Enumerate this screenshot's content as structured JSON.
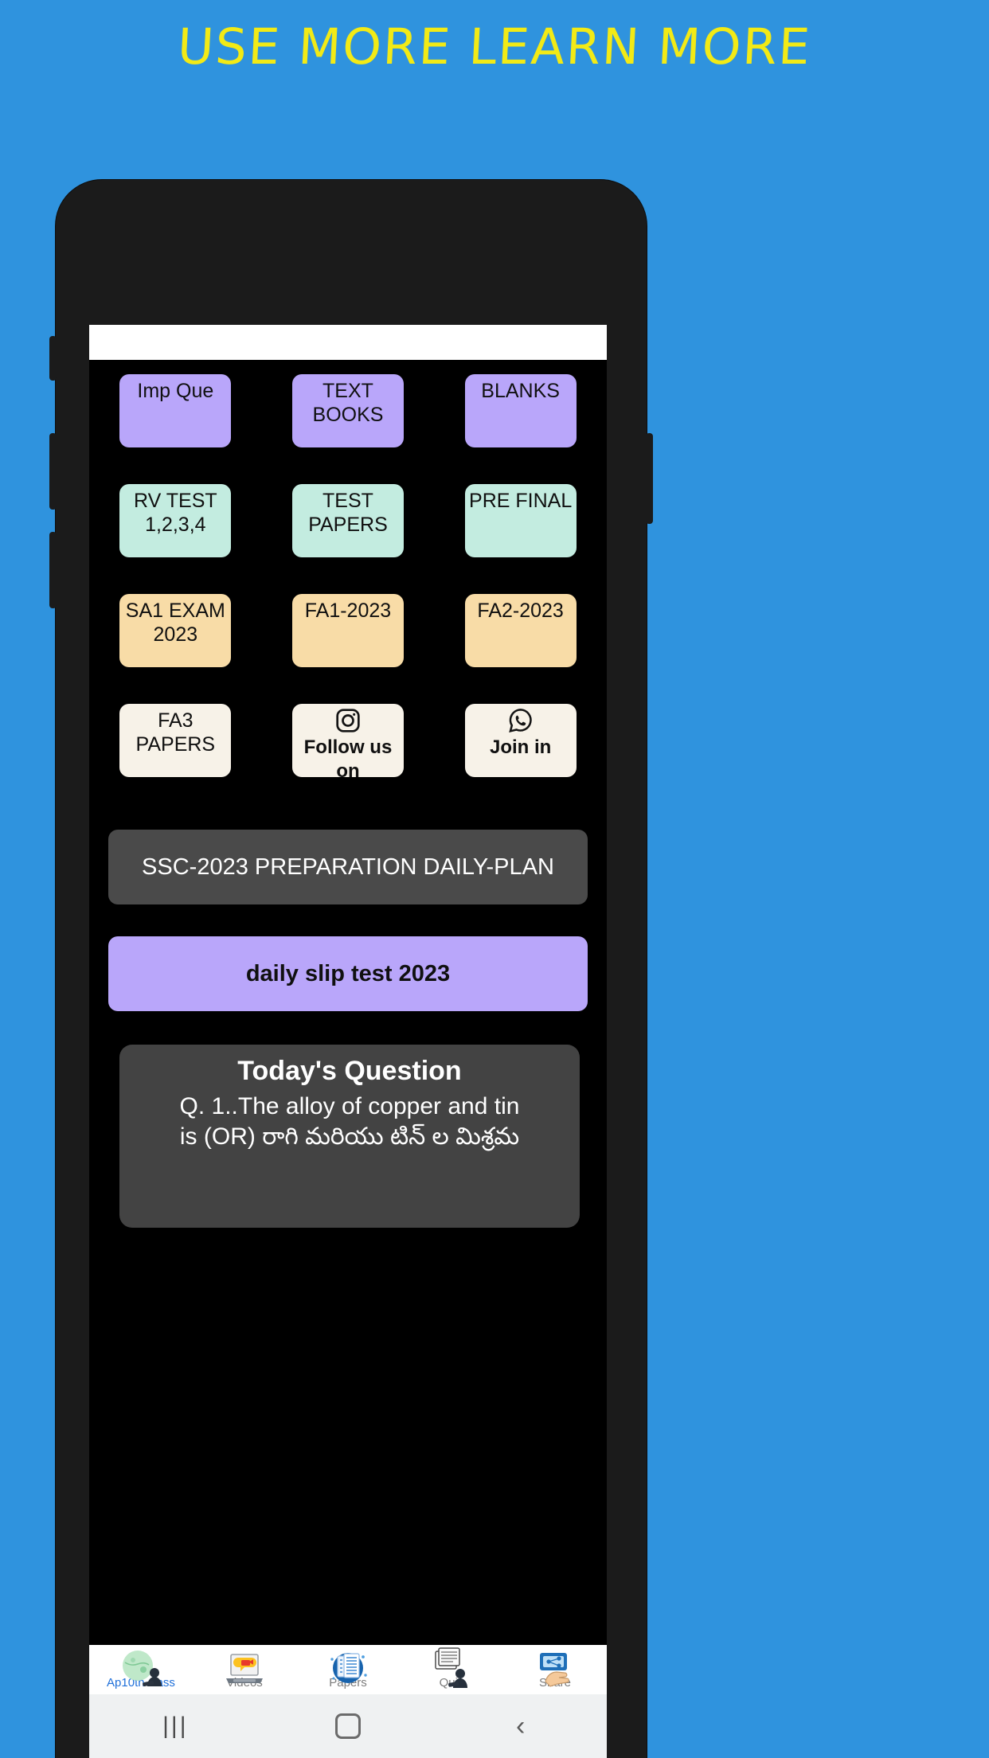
{
  "headline": "USE MORE LEARN MORE",
  "colors": {
    "page_background": "#2f93de",
    "headline_text": "#f2ea16",
    "phone_body": "#1b1b1b",
    "screen_background": "#000000",
    "tile_purple": "#b9a6fa",
    "tile_mint": "#c3ece0",
    "tile_peach": "#f8dca7",
    "tile_cream": "#f7f2e8",
    "banner_gray": "#4a4a4a",
    "card_gray": "#434343",
    "nav_active": "#1e6fd9",
    "nav_inactive": "#7c7c7c",
    "sysbar": "#eff1f2"
  },
  "tiles": [
    {
      "label": "Imp Que",
      "color": "#b9a6fa",
      "icon": null
    },
    {
      "label": "TEXT BOOKS",
      "color": "#b9a6fa",
      "icon": null
    },
    {
      "label": "BLANKS",
      "color": "#b9a6fa",
      "icon": null
    },
    {
      "label": "RV TEST 1,2,3,4",
      "color": "#c3ece0",
      "icon": null
    },
    {
      "label": "TEST PAPERS",
      "color": "#c3ece0",
      "icon": null
    },
    {
      "label": "PRE FINAL",
      "color": "#c3ece0",
      "icon": null
    },
    {
      "label": "SA1 EXAM 2023",
      "color": "#f8dca7",
      "icon": null
    },
    {
      "label": "FA1-2023",
      "color": "#f8dca7",
      "icon": null
    },
    {
      "label": "FA2-2023",
      "color": "#f8dca7",
      "icon": null
    },
    {
      "label": "FA3 PAPERS",
      "color": "#f7f2e8",
      "icon": null
    },
    {
      "label": "Follow us on",
      "color": "#f7f2e8",
      "icon": "instagram-icon"
    },
    {
      "label": "Join in",
      "color": "#f7f2e8",
      "icon": "whatsapp-icon"
    }
  ],
  "banners": {
    "ssc_plan": "SSC-2023 PREPARATION DAILY-PLAN",
    "slip_test": "daily slip test 2023"
  },
  "question_card": {
    "title": "Today's Question",
    "line1": "Q. 1..The alloy of copper and tin",
    "line2": "is (OR) రాగి మరియు టిన్ ల మిశ్రమ"
  },
  "bottom_nav": [
    {
      "label": "Ap10th class",
      "icon": "globe-student-icon",
      "active": true
    },
    {
      "label": "Videos",
      "icon": "laptop-video-icon",
      "active": false
    },
    {
      "label": "Papers",
      "icon": "documents-icon",
      "active": false
    },
    {
      "label": "Quiz",
      "icon": "quiz-papers-icon",
      "active": false
    },
    {
      "label": "Share",
      "icon": "share-hand-icon",
      "active": false
    }
  ],
  "system_bar": {
    "recent_label": "|||",
    "home_label": "",
    "back_label": "‹"
  }
}
